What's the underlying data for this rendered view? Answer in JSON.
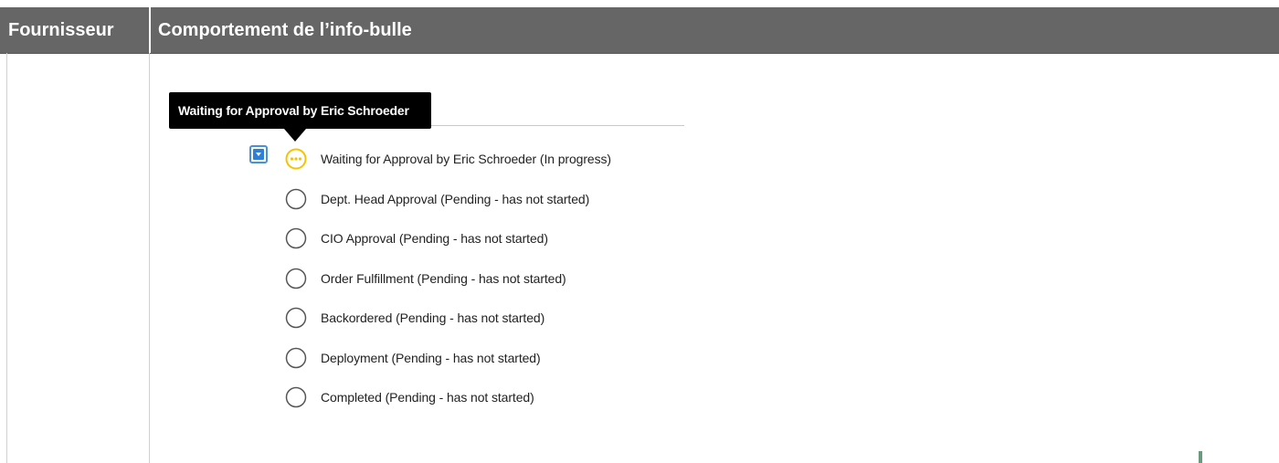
{
  "header": {
    "col1_label": "Fournisseur",
    "col2_label": "Comportement de l’info-bulle"
  },
  "tooltip": {
    "text": "Waiting for Approval by Eric Schroeder"
  },
  "stages": [
    {
      "label": "Waiting for Approval by Eric Schroeder (In progress)",
      "state": "in-progress",
      "icon": "in-progress-icon"
    },
    {
      "label": "Dept. Head Approval (Pending - has not started)",
      "state": "pending",
      "icon": "pending-circle-icon"
    },
    {
      "label": "CIO Approval (Pending - has not started)",
      "state": "pending",
      "icon": "pending-circle-icon"
    },
    {
      "label": "Order Fulfillment (Pending - has not started)",
      "state": "pending",
      "icon": "pending-circle-icon"
    },
    {
      "label": "Backordered (Pending - has not started)",
      "state": "pending",
      "icon": "pending-circle-icon"
    },
    {
      "label": "Deployment (Pending - has not started)",
      "state": "pending",
      "icon": "pending-circle-icon"
    },
    {
      "label": "Completed (Pending - has not started)",
      "state": "pending",
      "icon": "pending-circle-icon"
    }
  ],
  "colors": {
    "header_bg": "#666666",
    "tooltip_bg": "#000000",
    "in_progress": "#f5c400",
    "pending_stroke": "#555555",
    "toggle_blue": "#2f7fd6"
  }
}
